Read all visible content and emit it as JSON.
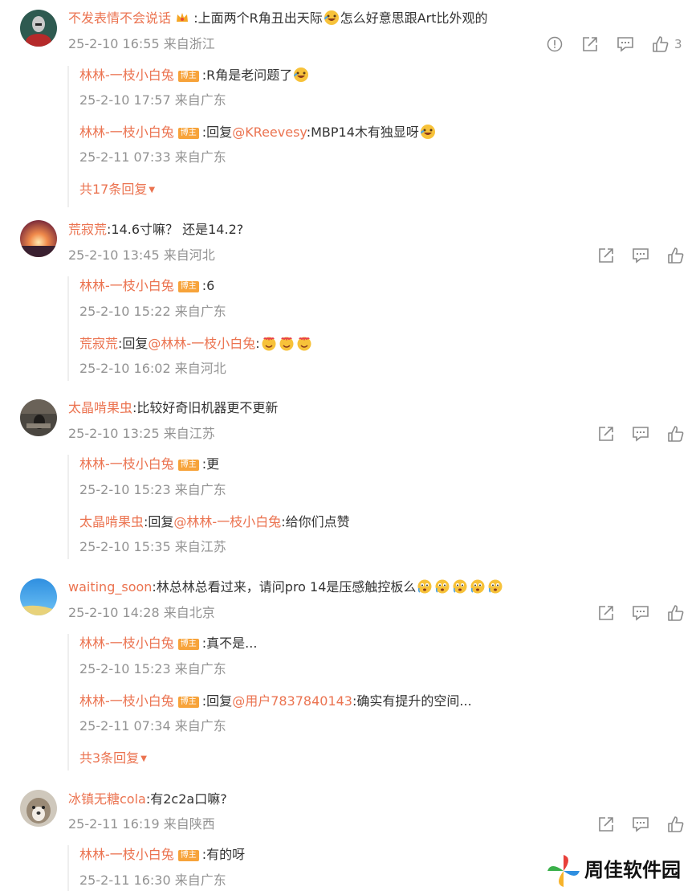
{
  "colors": {
    "link": "#eb7350",
    "meta": "#939393",
    "badge": "#f7a33a",
    "text": "#333333"
  },
  "badge_label": "博主",
  "comments": [
    {
      "user": "不发表情不会说话",
      "text": ":上面两个R角丑出天际",
      "text2": "怎么好意思跟Art比外观的",
      "meta": "25-2-10 16:55 来自浙江",
      "like_count": "3",
      "replies": [
        {
          "user": "林林-一枝小白兔",
          "text": ":R角是老问题了",
          "meta": "25-2-10 17:57 来自广东"
        },
        {
          "user": "林林-一枝小白兔",
          "text_prefix": ":回复",
          "at": "@KReevesy",
          "text": ":MBP14木有独显呀",
          "meta": "25-2-11 07:33 来自广东"
        }
      ],
      "more": "共17条回复"
    },
    {
      "user": "荒寂荒",
      "text": ":14.6寸嘛？ 还是14.2?",
      "meta": "25-2-10 13:45 来自河北",
      "replies": [
        {
          "user": "林林-一枝小白兔",
          "text": ":6",
          "meta": "25-2-10 15:22 来自广东"
        },
        {
          "user": "荒寂荒",
          "text_prefix": ":回复",
          "at": "@林林-一枝小白兔",
          "text": ":",
          "meta": "25-2-10 16:02 来自河北"
        }
      ]
    },
    {
      "user": "太晶啃果虫",
      "text": ":比较好奇旧机器更不更新",
      "meta": "25-2-10 13:25 来自江苏",
      "replies": [
        {
          "user": "林林-一枝小白兔",
          "text": ":更",
          "meta": "25-2-10 15:23 来自广东"
        },
        {
          "user": "太晶啃果虫",
          "text_prefix": ":回复",
          "at": "@林林-一枝小白兔",
          "text": ":给你们点赞",
          "meta": "25-2-10 15:35 来自江苏"
        }
      ]
    },
    {
      "user": "waiting_soon",
      "text": ":林总林总看过来，请问pro 14是压感触控板么",
      "meta": "25-2-10 14:28 来自北京",
      "replies": [
        {
          "user": "林林-一枝小白兔",
          "text": ":真不是...",
          "meta": "25-2-10 15:23 来自广东"
        },
        {
          "user": "林林-一枝小白兔",
          "text_prefix": ":回复",
          "at": "@用户7837840143",
          "text": ":确实有提升的空间...",
          "meta": "25-2-11 07:34 来自广东"
        }
      ],
      "more": "共3条回复"
    },
    {
      "user": "冰镇无糖cola",
      "text": ":有2c2a口嘛?",
      "meta": "25-2-11 16:19 来自陕西",
      "replies": [
        {
          "user": "林林-一枝小白兔",
          "text": ":有的呀",
          "meta": "25-2-11 16:30 来自广东"
        }
      ]
    }
  ],
  "watermark": {
    "text": "周佳软件园"
  }
}
